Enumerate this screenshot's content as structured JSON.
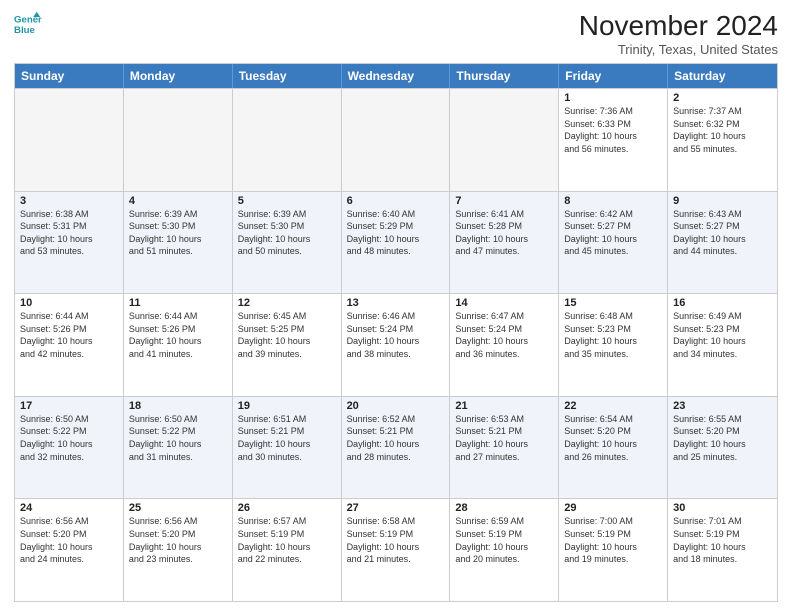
{
  "header": {
    "logo_line1": "General",
    "logo_line2": "Blue",
    "month": "November 2024",
    "location": "Trinity, Texas, United States"
  },
  "days_of_week": [
    "Sunday",
    "Monday",
    "Tuesday",
    "Wednesday",
    "Thursday",
    "Friday",
    "Saturday"
  ],
  "weeks": [
    [
      {
        "num": "",
        "info": "",
        "empty": true
      },
      {
        "num": "",
        "info": "",
        "empty": true
      },
      {
        "num": "",
        "info": "",
        "empty": true
      },
      {
        "num": "",
        "info": "",
        "empty": true
      },
      {
        "num": "",
        "info": "",
        "empty": true
      },
      {
        "num": "1",
        "info": "Sunrise: 7:36 AM\nSunset: 6:33 PM\nDaylight: 10 hours\nand 56 minutes.",
        "empty": false
      },
      {
        "num": "2",
        "info": "Sunrise: 7:37 AM\nSunset: 6:32 PM\nDaylight: 10 hours\nand 55 minutes.",
        "empty": false
      }
    ],
    [
      {
        "num": "3",
        "info": "Sunrise: 6:38 AM\nSunset: 5:31 PM\nDaylight: 10 hours\nand 53 minutes.",
        "empty": false
      },
      {
        "num": "4",
        "info": "Sunrise: 6:39 AM\nSunset: 5:30 PM\nDaylight: 10 hours\nand 51 minutes.",
        "empty": false
      },
      {
        "num": "5",
        "info": "Sunrise: 6:39 AM\nSunset: 5:30 PM\nDaylight: 10 hours\nand 50 minutes.",
        "empty": false
      },
      {
        "num": "6",
        "info": "Sunrise: 6:40 AM\nSunset: 5:29 PM\nDaylight: 10 hours\nand 48 minutes.",
        "empty": false
      },
      {
        "num": "7",
        "info": "Sunrise: 6:41 AM\nSunset: 5:28 PM\nDaylight: 10 hours\nand 47 minutes.",
        "empty": false
      },
      {
        "num": "8",
        "info": "Sunrise: 6:42 AM\nSunset: 5:27 PM\nDaylight: 10 hours\nand 45 minutes.",
        "empty": false
      },
      {
        "num": "9",
        "info": "Sunrise: 6:43 AM\nSunset: 5:27 PM\nDaylight: 10 hours\nand 44 minutes.",
        "empty": false
      }
    ],
    [
      {
        "num": "10",
        "info": "Sunrise: 6:44 AM\nSunset: 5:26 PM\nDaylight: 10 hours\nand 42 minutes.",
        "empty": false
      },
      {
        "num": "11",
        "info": "Sunrise: 6:44 AM\nSunset: 5:26 PM\nDaylight: 10 hours\nand 41 minutes.",
        "empty": false
      },
      {
        "num": "12",
        "info": "Sunrise: 6:45 AM\nSunset: 5:25 PM\nDaylight: 10 hours\nand 39 minutes.",
        "empty": false
      },
      {
        "num": "13",
        "info": "Sunrise: 6:46 AM\nSunset: 5:24 PM\nDaylight: 10 hours\nand 38 minutes.",
        "empty": false
      },
      {
        "num": "14",
        "info": "Sunrise: 6:47 AM\nSunset: 5:24 PM\nDaylight: 10 hours\nand 36 minutes.",
        "empty": false
      },
      {
        "num": "15",
        "info": "Sunrise: 6:48 AM\nSunset: 5:23 PM\nDaylight: 10 hours\nand 35 minutes.",
        "empty": false
      },
      {
        "num": "16",
        "info": "Sunrise: 6:49 AM\nSunset: 5:23 PM\nDaylight: 10 hours\nand 34 minutes.",
        "empty": false
      }
    ],
    [
      {
        "num": "17",
        "info": "Sunrise: 6:50 AM\nSunset: 5:22 PM\nDaylight: 10 hours\nand 32 minutes.",
        "empty": false
      },
      {
        "num": "18",
        "info": "Sunrise: 6:50 AM\nSunset: 5:22 PM\nDaylight: 10 hours\nand 31 minutes.",
        "empty": false
      },
      {
        "num": "19",
        "info": "Sunrise: 6:51 AM\nSunset: 5:21 PM\nDaylight: 10 hours\nand 30 minutes.",
        "empty": false
      },
      {
        "num": "20",
        "info": "Sunrise: 6:52 AM\nSunset: 5:21 PM\nDaylight: 10 hours\nand 28 minutes.",
        "empty": false
      },
      {
        "num": "21",
        "info": "Sunrise: 6:53 AM\nSunset: 5:21 PM\nDaylight: 10 hours\nand 27 minutes.",
        "empty": false
      },
      {
        "num": "22",
        "info": "Sunrise: 6:54 AM\nSunset: 5:20 PM\nDaylight: 10 hours\nand 26 minutes.",
        "empty": false
      },
      {
        "num": "23",
        "info": "Sunrise: 6:55 AM\nSunset: 5:20 PM\nDaylight: 10 hours\nand 25 minutes.",
        "empty": false
      }
    ],
    [
      {
        "num": "24",
        "info": "Sunrise: 6:56 AM\nSunset: 5:20 PM\nDaylight: 10 hours\nand 24 minutes.",
        "empty": false
      },
      {
        "num": "25",
        "info": "Sunrise: 6:56 AM\nSunset: 5:20 PM\nDaylight: 10 hours\nand 23 minutes.",
        "empty": false
      },
      {
        "num": "26",
        "info": "Sunrise: 6:57 AM\nSunset: 5:19 PM\nDaylight: 10 hours\nand 22 minutes.",
        "empty": false
      },
      {
        "num": "27",
        "info": "Sunrise: 6:58 AM\nSunset: 5:19 PM\nDaylight: 10 hours\nand 21 minutes.",
        "empty": false
      },
      {
        "num": "28",
        "info": "Sunrise: 6:59 AM\nSunset: 5:19 PM\nDaylight: 10 hours\nand 20 minutes.",
        "empty": false
      },
      {
        "num": "29",
        "info": "Sunrise: 7:00 AM\nSunset: 5:19 PM\nDaylight: 10 hours\nand 19 minutes.",
        "empty": false
      },
      {
        "num": "30",
        "info": "Sunrise: 7:01 AM\nSunset: 5:19 PM\nDaylight: 10 hours\nand 18 minutes.",
        "empty": false
      }
    ]
  ]
}
